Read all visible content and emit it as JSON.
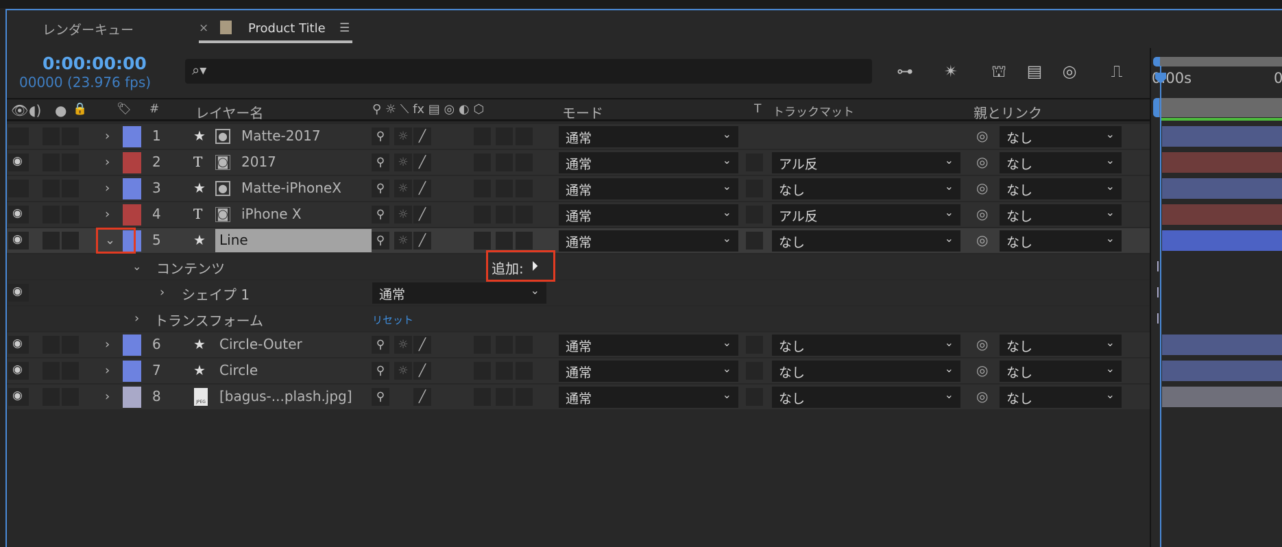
{
  "tabs": {
    "render_queue": "レンダーキュー",
    "close": "×",
    "comp": "Product Title",
    "menu": "☰",
    "comp_color": "#a89a80"
  },
  "timecode": "0:00:00:00",
  "frames": "00000 (23.976 fps)",
  "search": {
    "placeholder": "",
    "icon": "⌕▾"
  },
  "toolbar": [
    "composition-flowchart",
    "draft-3d",
    "shy-layers",
    "frame-blending",
    "motion-blur",
    "graph-editor"
  ],
  "timeline": {
    "ruler_label": "0:00s",
    "ruler_label2": "0"
  },
  "header": {
    "eye": "👁",
    "av": "◖)",
    "solo": "●",
    "lock": "🔒",
    "label": "🏷",
    "num": "#",
    "name": "レイヤー名",
    "switches": "⚲ ☼ ⟍ fx ▤ ◎ ◐ ⬡",
    "mode": "モード",
    "t": "T",
    "trackmatte": "トラックマット",
    "parent": "親とリンク"
  },
  "layers": [
    {
      "num": "1",
      "type": "★",
      "name": "Matte-2017",
      "color": "#6d82e0",
      "eye": false,
      "mode": "通常",
      "trkmat": "",
      "parent": "なし",
      "bar": "#4f5a8a"
    },
    {
      "num": "2",
      "type": "T",
      "name": "2017",
      "color": "#b04040",
      "eye": true,
      "mode": "通常",
      "trkmat": "アル反",
      "parent": "なし",
      "bar": "#6e3c3b"
    },
    {
      "num": "3",
      "type": "★",
      "name": "Matte-iPhoneX",
      "color": "#6d82e0",
      "eye": false,
      "mode": "通常",
      "trkmat": "なし",
      "parent": "なし",
      "bar": "#4f5a8a"
    },
    {
      "num": "4",
      "type": "T",
      "name": "iPhone X",
      "color": "#b04040",
      "eye": true,
      "mode": "通常",
      "trkmat": "アル反",
      "parent": "なし",
      "bar": "#6e3c3b"
    },
    {
      "num": "5",
      "type": "★",
      "name": "Line",
      "color": "#6d82e0",
      "eye": true,
      "mode": "通常",
      "trkmat": "なし",
      "parent": "なし",
      "bar": "#4c62c4",
      "selected": true,
      "expanded": true
    },
    {
      "num": "6",
      "type": "★",
      "name": "Circle-Outer",
      "color": "#6d82e0",
      "eye": true,
      "mode": "通常",
      "trkmat": "なし",
      "parent": "なし",
      "bar": "#4f5a8a"
    },
    {
      "num": "7",
      "type": "★",
      "name": "Circle",
      "color": "#6d82e0",
      "eye": true,
      "mode": "通常",
      "trkmat": "なし",
      "parent": "なし",
      "bar": "#4f5a8a"
    },
    {
      "num": "8",
      "type": "JPEG",
      "name": "[bagus-...plash.jpg]",
      "color": "#a9a9c8",
      "eye": true,
      "mode": "通常",
      "trkmat": "なし",
      "parent": "なし",
      "bar": "#6f6f7a",
      "noCollapse": true
    }
  ],
  "contents": {
    "label": "コンテンツ",
    "add": "追加:",
    "shape": "シェイプ 1",
    "shape_mode": "通常",
    "transform": "トランスフォーム",
    "reset": "リセット"
  }
}
